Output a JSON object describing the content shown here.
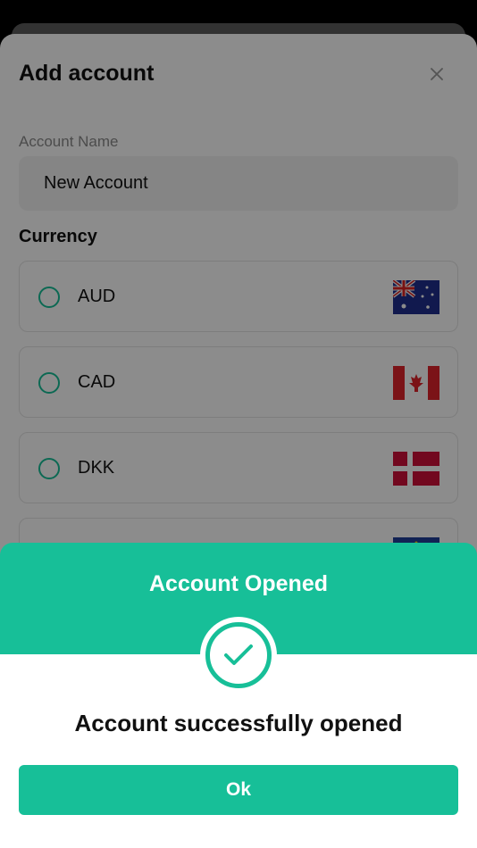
{
  "sheet": {
    "title": "Add account",
    "close_icon": "close-icon",
    "account_name_label": "Account Name",
    "account_name_value": "New Account",
    "currency_label": "Currency",
    "currencies": [
      {
        "code": "AUD",
        "flag": "australia-flag-icon"
      },
      {
        "code": "CAD",
        "flag": "canada-flag-icon"
      },
      {
        "code": "DKK",
        "flag": "denmark-flag-icon"
      },
      {
        "code": "",
        "flag": "european-union-flag-icon"
      }
    ]
  },
  "modal": {
    "title": "Account Opened",
    "message": "Account successfully opened",
    "ok_label": "Ok",
    "icon": "checkmark-icon"
  },
  "colors": {
    "accent": "#17bf98",
    "overlay": "rgba(0,0,0,0.45)"
  }
}
